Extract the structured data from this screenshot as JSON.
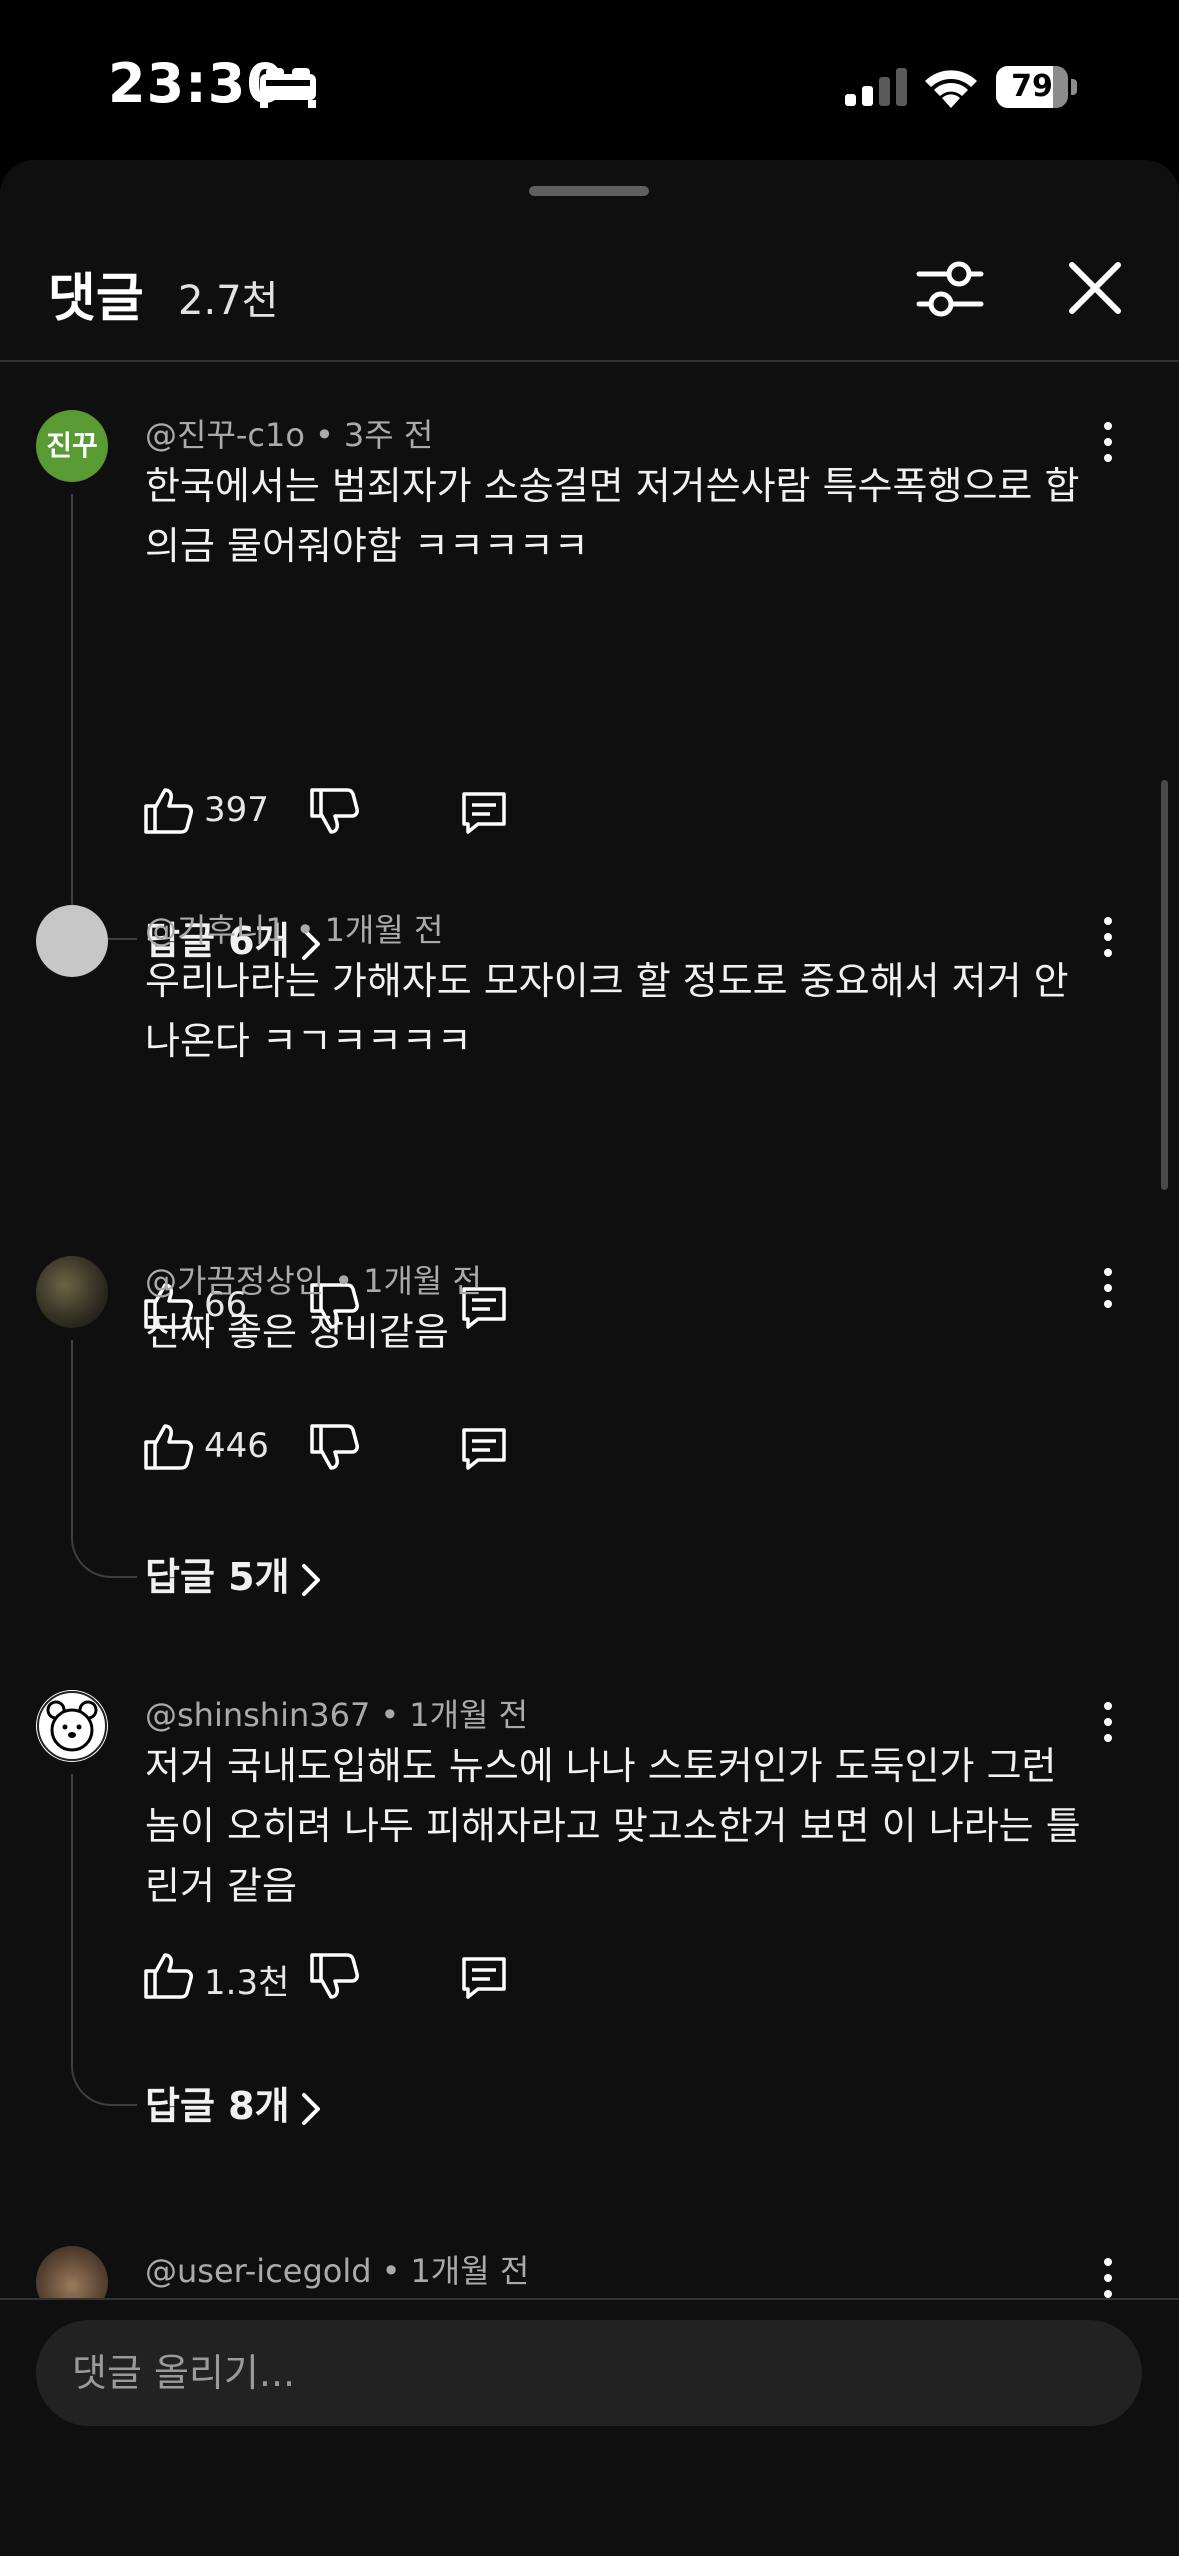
{
  "status_bar": {
    "time": "23:30",
    "battery": "79",
    "battery_level": 0.79
  },
  "header": {
    "title": "댓글",
    "count": "2.7천"
  },
  "comments": [
    {
      "avatar_text": "진꾸",
      "author": "@진꾸-c1o",
      "time": "3주 전",
      "text": "한국에서는 범죄자가  소송걸면 저거쓴사람 특수폭행으로 합의금 물어줘야함 ㅋㅋㅋㅋㅋ",
      "likes": "397",
      "replies": "답글 6개"
    },
    {
      "author": "@기후니1",
      "time": "1개월 전",
      "text": "우리나라는 가해자도 모자이크 할 정도로 중요해서 저거 안나온다 ㅋㄱㅋㅋㅋㅋ",
      "likes": "66"
    },
    {
      "author": "@가끔정상인",
      "time": "1개월 전",
      "text": "진짜 좋은 장비같음",
      "likes": "446",
      "replies": "답글 5개"
    },
    {
      "author": "@shinshin367",
      "time": "1개월 전",
      "text": "저거 국내도입해도  뉴스에 나나 스토커인가 도둑인가 그런놈이 오히려 나두 피해자라고 맞고소한거 보면 이 나라는 틀린거 같음",
      "likes": "1.3천",
      "replies": "답글 8개"
    },
    {
      "author": "@user-icegold",
      "time": "1개월 전"
    }
  ],
  "input": {
    "placeholder": "댓글 올리기..."
  }
}
